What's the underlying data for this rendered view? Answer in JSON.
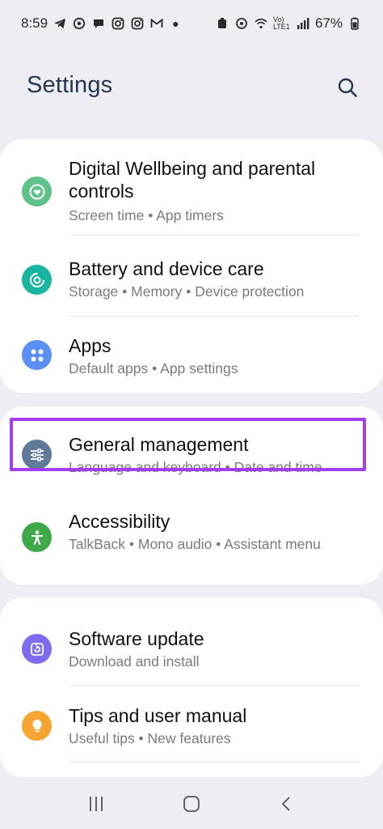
{
  "status_bar": {
    "time": "8:59",
    "battery": "67%",
    "network_label": "Vo) LTE1",
    "notification_icons": [
      "telegram-icon",
      "whatsapp-icon",
      "chat-icon",
      "instagram-icon",
      "instagram-icon",
      "gmail-icon"
    ],
    "system_icons": [
      "alarm-icon",
      "location-icon",
      "wifi-icon",
      "signal-icon",
      "battery-icon"
    ]
  },
  "header": {
    "title": "Settings",
    "search_icon": "search-icon"
  },
  "settings": [
    {
      "title": "Digital Wellbeing and parental controls",
      "subtitle": "Screen time  •  App timers",
      "icon": "digital-wellbeing-icon",
      "color": "#5ec28a"
    },
    {
      "title": "Battery and device care",
      "subtitle": "Storage  •  Memory  •  Device protection",
      "icon": "device-care-icon",
      "color": "#19b5a0"
    },
    {
      "title": "Apps",
      "subtitle": "Default apps  •  App settings",
      "icon": "apps-icon",
      "color": "#5a8ff6"
    },
    {
      "title": "General management",
      "subtitle": "Language and keyboard  •  Date and time",
      "icon": "general-management-icon",
      "color": "#5f7a94"
    },
    {
      "title": "Accessibility",
      "subtitle": "TalkBack  •  Mono audio  •  Assistant menu",
      "icon": "accessibility-icon",
      "color": "#3ea84a"
    },
    {
      "title": "Software update",
      "subtitle": "Download and install",
      "icon": "software-update-icon",
      "color": "#7b6cf0"
    },
    {
      "title": "Tips and user manual",
      "subtitle": "Useful tips  •  New features",
      "icon": "tips-icon",
      "color": "#f7a531"
    }
  ],
  "colors": {
    "background": "#ededf3",
    "card": "#ffffff",
    "highlight_border": "#a23df0",
    "title_text": "#26364f"
  },
  "nav_bar": {
    "recents_icon": "recents-icon",
    "home_icon": "home-icon",
    "back_icon": "back-icon"
  }
}
